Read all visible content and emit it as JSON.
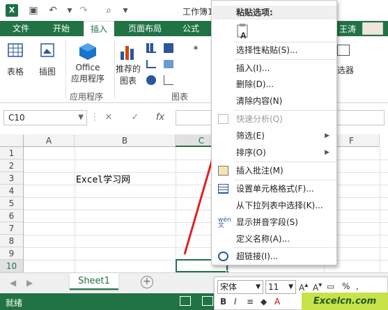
{
  "titlebar": {
    "title": "工作簿1 - Ex"
  },
  "tabs": [
    {
      "label": "文件"
    },
    {
      "label": "开始"
    },
    {
      "label": "插入"
    },
    {
      "label": "页面布局"
    },
    {
      "label": "公式"
    }
  ],
  "user": "王涛",
  "ribbon": {
    "table": "表格",
    "illustrations": "插图",
    "office_apps_1": "Office",
    "office_apps_2": "应用程序",
    "apps_group": "应用程序",
    "recommended_1": "推荐的",
    "recommended_2": "图表",
    "charts_group": "图表",
    "filter_partial": "选器"
  },
  "namebox": {
    "value": "C10"
  },
  "formula": {
    "fx": "fx",
    "cancel": "✕",
    "enter": "✓"
  },
  "columns": [
    "A",
    "B",
    "C",
    "F"
  ],
  "rows": [
    "1",
    "2",
    "3",
    "4",
    "5",
    "6",
    "7",
    "8",
    "9",
    "10"
  ],
  "cells": {
    "B3": "Excel学习网"
  },
  "sheet": {
    "name": "Sheet1"
  },
  "status": {
    "ready": "就绪"
  },
  "context_menu": {
    "paste_header": "粘贴选项:",
    "items": [
      {
        "label": "选择性粘贴(S)...",
        "disabled": false
      },
      {
        "label": "插入(I)...",
        "disabled": false
      },
      {
        "label": "删除(D)...",
        "disabled": false
      },
      {
        "label": "清除内容(N)",
        "disabled": false
      },
      {
        "label": "快速分析(Q)",
        "disabled": true
      },
      {
        "label": "筛选(E)",
        "disabled": false,
        "submenu": true
      },
      {
        "label": "排序(O)",
        "disabled": false,
        "submenu": true
      },
      {
        "label": "插入批注(M)",
        "disabled": false
      },
      {
        "label": "设置单元格格式(F)...",
        "disabled": false
      },
      {
        "label": "从下拉列表中选择(K)...",
        "disabled": false
      },
      {
        "label": "显示拼音字段(S)",
        "disabled": false
      },
      {
        "label": "定义名称(A)...",
        "disabled": false
      },
      {
        "label": "超链接(I)...",
        "disabled": false
      }
    ]
  },
  "mini_toolbar": {
    "font": "宋体",
    "size": "11",
    "percent": "%",
    "comma": ",",
    "bold": "B",
    "italic": "I"
  },
  "watermark": "Excelcn.com",
  "colors": {
    "excel_green": "#217346",
    "arrow_red": "#e02020"
  }
}
